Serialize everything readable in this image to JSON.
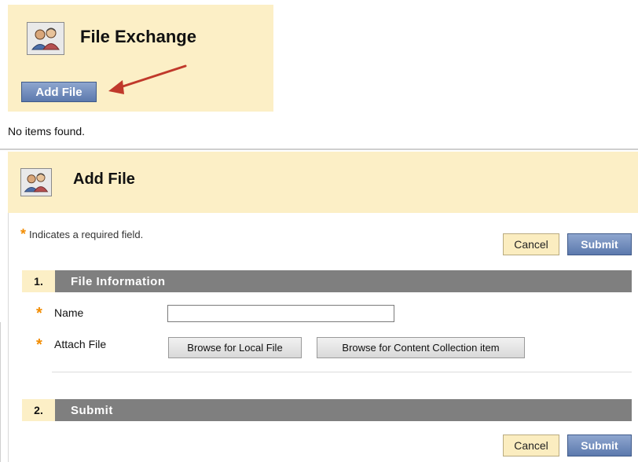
{
  "file_exchange": {
    "title": "File Exchange",
    "add_file_label": "Add File",
    "empty_message": "No items found."
  },
  "add_file_page": {
    "title": "Add File",
    "required_note": "Indicates a required field.",
    "required_star": "*",
    "cancel_label": "Cancel",
    "submit_label": "Submit",
    "sections": [
      {
        "number": "1.",
        "title": "File Information"
      },
      {
        "number": "2.",
        "title": "Submit"
      }
    ],
    "fields": {
      "name_label": "Name",
      "name_value": "",
      "attach_label": "Attach File",
      "browse_local_label": "Browse for Local File",
      "browse_collection_label": "Browse for Content Collection item"
    }
  },
  "colors": {
    "panel_bg": "#fcefc6",
    "section_bar": "#7f7f7f",
    "button_blue": "#5c79ad",
    "required_star": "#f28c00",
    "arrow": "#c0392b"
  },
  "icons": {
    "course_tool_icon": "group-people-icon"
  }
}
